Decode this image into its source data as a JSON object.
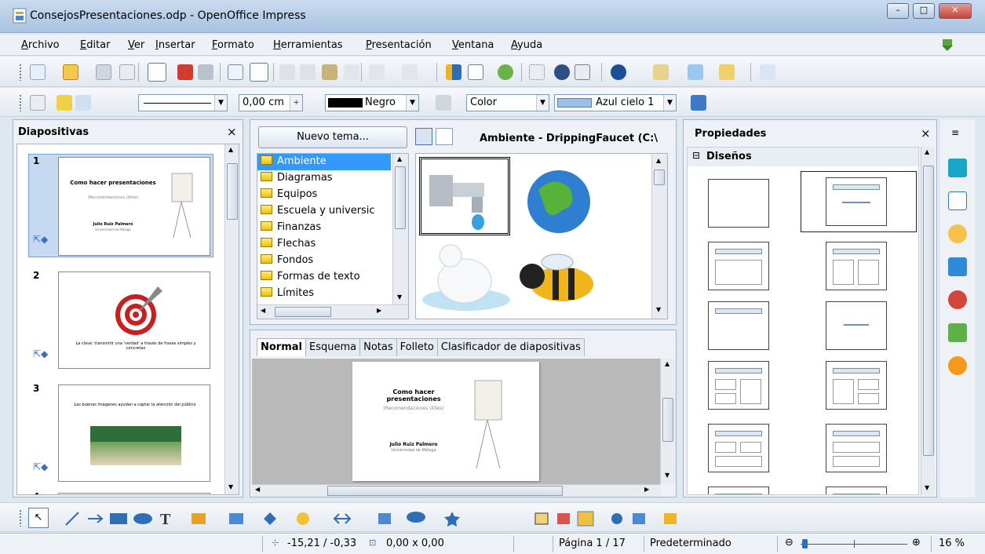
{
  "window": {
    "title": "ConsejosPresentaciones.odp - OpenOffice Impress",
    "controls": [
      "–",
      "□",
      "✕"
    ]
  },
  "menu": [
    "Archivo",
    "Editar",
    "Ver",
    "Insertar",
    "Formato",
    "Herramientas",
    "Presentación",
    "Ventana",
    "Ayuda"
  ],
  "line_toolbar": {
    "line_width": "0,00 cm",
    "line_color": "Negro",
    "area_style": "Color",
    "area_color": "Azul cielo 1"
  },
  "slides_pane": {
    "title": "Diapositivas",
    "close": "×",
    "slides": [
      {
        "number": "1",
        "title": "Como hacer presentaciones",
        "subtitle": "(Recomendaciones útiles)",
        "author": "Julio Ruiz Palmero",
        "org": "Universidad de Málaga"
      },
      {
        "number": "2",
        "caption": "La clave: transmitir una 'verdad' a través de frases simples y concretas"
      },
      {
        "number": "3",
        "caption": "Las buenas imagenes ayudan a captar la atención del público"
      },
      {
        "number": "4"
      }
    ]
  },
  "gallery": {
    "new_theme": "Nuevo tema...",
    "current_theme_label": "Ambiente - DrippingFaucet (C:\\",
    "themes": [
      "Ambiente",
      "Diagramas",
      "Equipos",
      "Escuela y universic",
      "Finanzas",
      "Flechas",
      "Fondos",
      "Formas de texto",
      "Límites"
    ],
    "items": [
      "dripping-faucet",
      "globe",
      "polar-bear",
      "bee"
    ]
  },
  "view_tabs": [
    "Normal",
    "Esquema",
    "Notas",
    "Folleto",
    "Clasificador de diapositivas"
  ],
  "editor_slide": {
    "title": "Como hacer presentaciones",
    "subtitle": "(Recomendaciones útiles)",
    "author": "Julio Ruiz Palmero",
    "org": "Universidad de Málaga"
  },
  "properties": {
    "title": "Propiedades",
    "close": "×",
    "section": "Diseños",
    "layouts": 10,
    "selected_layout_index": 1
  },
  "status": {
    "position": "-15,21 / -0,33",
    "size": "0,00 x 0,00",
    "page": "Página 1 / 17",
    "master": "Predeterminado",
    "zoom": "16 %"
  },
  "colors": {
    "accent": "#3b6fb6",
    "selection": "#3399ff",
    "window_frame": "#aac3e1",
    "close_red": "#c8413a"
  }
}
